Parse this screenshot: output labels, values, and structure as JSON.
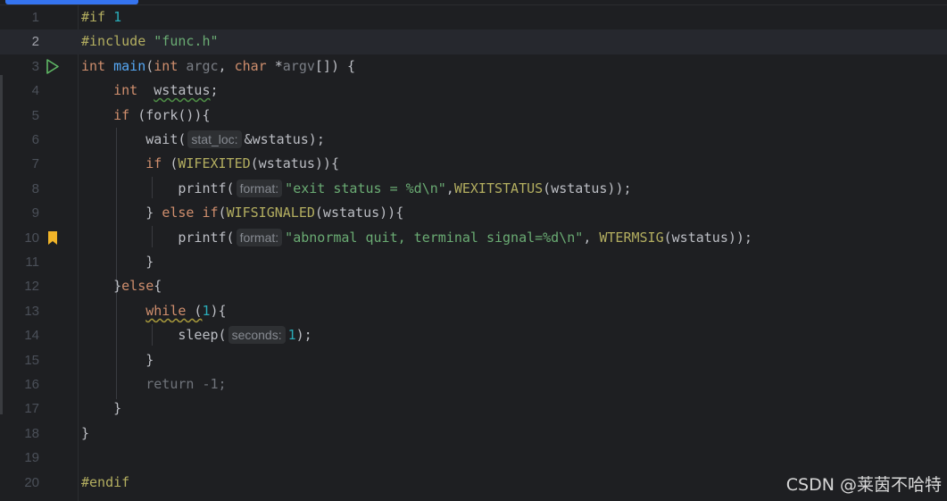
{
  "editor": {
    "lines": [
      {
        "n": "1"
      },
      {
        "n": "2"
      },
      {
        "n": "3"
      },
      {
        "n": "4"
      },
      {
        "n": "5"
      },
      {
        "n": "6"
      },
      {
        "n": "7"
      },
      {
        "n": "8"
      },
      {
        "n": "9"
      },
      {
        "n": "10"
      },
      {
        "n": "11"
      },
      {
        "n": "12"
      },
      {
        "n": "13"
      },
      {
        "n": "14"
      },
      {
        "n": "15"
      },
      {
        "n": "16"
      },
      {
        "n": "17"
      },
      {
        "n": "18"
      },
      {
        "n": "19"
      },
      {
        "n": "20"
      }
    ],
    "current_line": 2,
    "tokens": {
      "l1_kw": "#if",
      "l1_num": "1",
      "l2_kw": "#include",
      "l2_str": "\"func.h\"",
      "l3_int": "int",
      "l3_main": "main",
      "l3_paren": "(",
      "l3_int2": "int",
      "l3_argc": "argc",
      "l3_comma": ", ",
      "l3_char": "char",
      "l3_star": " *",
      "l3_argv": "argv",
      "l3_rest": "[]) {",
      "l4_int": "int",
      "l4_var": "wstatus",
      "l4_semi": ";",
      "l5_if": "if",
      "l5_rest": " (fork()){",
      "l6_fn": "wait(",
      "l6_hint": "stat_loc:",
      "l6_rest": "&wstatus);",
      "l7_if": "if",
      "l7_p": " (",
      "l7_macro": "WIFEXITED",
      "l7_rest": "(wstatus)){",
      "l8_fn": "printf(",
      "l8_hint": "format:",
      "l8_str": "\"exit status = %d\\n\"",
      "l8_comma": ",",
      "l8_macro": "WEXITSTATUS",
      "l8_rest": "(wstatus));",
      "l9_brace": "} ",
      "l9_else": "else",
      "l9_sp": " ",
      "l9_if": "if",
      "l9_p": "(",
      "l9_macro": "WIFSIGNALED",
      "l9_rest": "(wstatus)){",
      "l10_fn": "printf(",
      "l10_hint": "format:",
      "l10_str": "\"abnormal quit, terminal signal=%d\\n\"",
      "l10_comma": ", ",
      "l10_macro": "WTERMSIG",
      "l10_rest": "(wstatus));",
      "l11": "}",
      "l12_brace": "}",
      "l12_else": "else",
      "l12_rest": "{",
      "l13_while": "while",
      "l13_p": " (",
      "l13_num": "1",
      "l13_rest": "){",
      "l14_fn": "sleep(",
      "l14_hint": "seconds:",
      "l14_num": "1",
      "l14_rest": ");",
      "l15": "}",
      "l16": "return -1;",
      "l17": "}",
      "l18": "}",
      "l20": "#endif"
    },
    "icons": {
      "line3": "run-icon",
      "line10": "bookmark-icon"
    },
    "colors": {
      "run": "#5fb865",
      "bookmark": "#f0b429",
      "accent": "#3574f0"
    }
  },
  "watermark": "CSDN @莱茵不哈特"
}
